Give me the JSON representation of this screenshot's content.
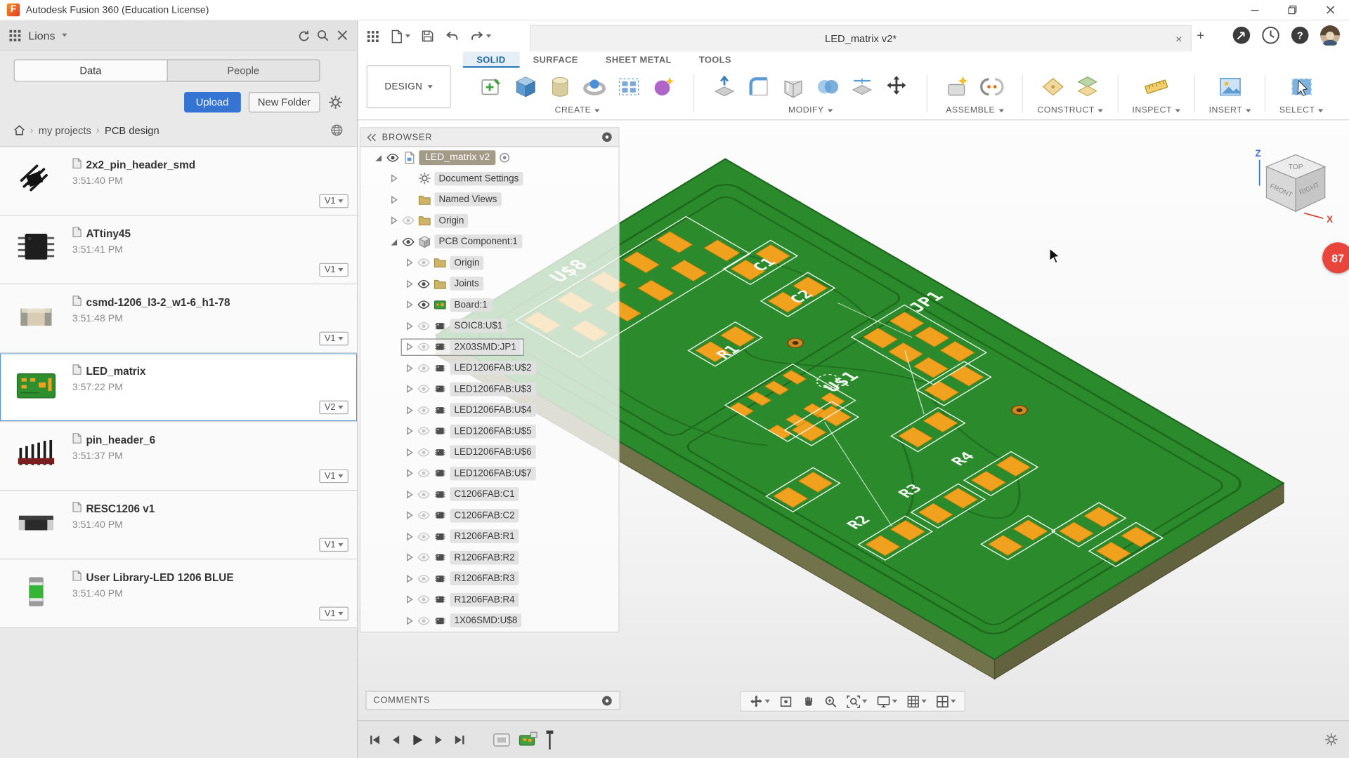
{
  "colors": {
    "accent_blue": "#3574d3",
    "board_green": "#2b8a2b",
    "pad_orange": "#f0a11e",
    "badge_red": "#e8453c",
    "active_tab_blue": "#1a6fb5"
  },
  "titlebar": {
    "title": "Autodesk Fusion 360 (Education License)"
  },
  "data_panel": {
    "team_name": "Lions",
    "tabs": [
      "Data",
      "People"
    ],
    "active_tab": "Data",
    "upload": "Upload",
    "new_folder": "New Folder",
    "breadcrumb": [
      "my projects",
      "PCB design"
    ],
    "items": [
      {
        "name": "2x2_pin_header_smd",
        "time": "3:51:40 PM",
        "version": "V1",
        "thumb": "pin-header-2x2",
        "selected": false
      },
      {
        "name": "ATtiny45",
        "time": "3:51:41 PM",
        "version": "V1",
        "thumb": "attiny45",
        "selected": false
      },
      {
        "name": "csmd-1206_l3-2_w1-6_h1-78",
        "time": "3:51:48 PM",
        "version": "V1",
        "thumb": "capacitor",
        "selected": false
      },
      {
        "name": "LED_matrix",
        "time": "3:57:22 PM",
        "version": "V2",
        "thumb": "pcb",
        "selected": true
      },
      {
        "name": "pin_header_6",
        "time": "3:51:37 PM",
        "version": "V1",
        "thumb": "pin-header-6",
        "selected": false
      },
      {
        "name": "RESC1206 v1",
        "time": "3:51:40 PM",
        "version": "V1",
        "thumb": "resistor",
        "selected": false
      },
      {
        "name": "User Library-LED 1206 BLUE",
        "time": "3:51:40 PM",
        "version": "V1",
        "thumb": "led",
        "selected": false
      }
    ]
  },
  "app_toolbar": {
    "document_tab": "LED_matrix v2*"
  },
  "ribbon": {
    "design_button": "DESIGN",
    "tabs": [
      {
        "label": "SOLID",
        "active": true
      },
      {
        "label": "SURFACE",
        "active": false
      },
      {
        "label": "SHEET METAL",
        "active": false
      },
      {
        "label": "TOOLS",
        "active": false
      }
    ],
    "groups": [
      "CREATE",
      "MODIFY",
      "ASSEMBLE",
      "CONSTRUCT",
      "INSPECT",
      "INSERT",
      "SELECT"
    ]
  },
  "browser": {
    "header": "BROWSER",
    "root": {
      "label": "LED_matrix v2"
    },
    "items": [
      {
        "label": "Document Settings",
        "depth": 1,
        "icon": "gear",
        "eye": "none",
        "expanded": false,
        "boxed": false
      },
      {
        "label": "Named Views",
        "depth": 1,
        "icon": "folder",
        "eye": "none",
        "expanded": false,
        "boxed": false
      },
      {
        "label": "Origin",
        "depth": 1,
        "icon": "folder",
        "eye": "dim",
        "expanded": false,
        "boxed": false
      },
      {
        "label": "PCB Component:1",
        "depth": 1,
        "icon": "component",
        "eye": "on",
        "expanded": true,
        "boxed": false
      },
      {
        "label": "Origin",
        "depth": 2,
        "icon": "folder",
        "eye": "dim",
        "expanded": false,
        "boxed": false
      },
      {
        "label": "Joints",
        "depth": 2,
        "icon": "folder",
        "eye": "on",
        "expanded": false,
        "boxed": false
      },
      {
        "label": "Board:1",
        "depth": 2,
        "icon": "board",
        "eye": "on",
        "expanded": false,
        "boxed": false
      },
      {
        "label": "SOIC8:U$1",
        "depth": 2,
        "icon": "chip",
        "eye": "dim",
        "expanded": false,
        "boxed": false
      },
      {
        "label": "2X03SMD:JP1",
        "depth": 2,
        "icon": "chip",
        "eye": "dim",
        "expanded": false,
        "boxed": true
      },
      {
        "label": "LED1206FAB:U$2",
        "depth": 2,
        "icon": "chip",
        "eye": "dim",
        "expanded": false,
        "boxed": false
      },
      {
        "label": "LED1206FAB:U$3",
        "depth": 2,
        "icon": "chip",
        "eye": "dim",
        "expanded": false,
        "boxed": false
      },
      {
        "label": "LED1206FAB:U$4",
        "depth": 2,
        "icon": "chip",
        "eye": "dim",
        "expanded": false,
        "boxed": false
      },
      {
        "label": "LED1206FAB:U$5",
        "depth": 2,
        "icon": "chip",
        "eye": "dim",
        "expanded": false,
        "boxed": false
      },
      {
        "label": "LED1206FAB:U$6",
        "depth": 2,
        "icon": "chip",
        "eye": "dim",
        "expanded": false,
        "boxed": false
      },
      {
        "label": "LED1206FAB:U$7",
        "depth": 2,
        "icon": "chip",
        "eye": "dim",
        "expanded": false,
        "boxed": false
      },
      {
        "label": "C1206FAB:C1",
        "depth": 2,
        "icon": "chip",
        "eye": "dim",
        "expanded": false,
        "boxed": false
      },
      {
        "label": "C1206FAB:C2",
        "depth": 2,
        "icon": "chip",
        "eye": "dim",
        "expanded": false,
        "boxed": false
      },
      {
        "label": "R1206FAB:R1",
        "depth": 2,
        "icon": "chip",
        "eye": "dim",
        "expanded": false,
        "boxed": false
      },
      {
        "label": "R1206FAB:R2",
        "depth": 2,
        "icon": "chip",
        "eye": "dim",
        "expanded": false,
        "boxed": false
      },
      {
        "label": "R1206FAB:R3",
        "depth": 2,
        "icon": "chip",
        "eye": "dim",
        "expanded": false,
        "boxed": false
      },
      {
        "label": "R1206FAB:R4",
        "depth": 2,
        "icon": "chip",
        "eye": "dim",
        "expanded": false,
        "boxed": false
      },
      {
        "label": "1X06SMD:U$8",
        "depth": 2,
        "icon": "chip",
        "eye": "dim",
        "expanded": false,
        "boxed": false
      }
    ]
  },
  "viewport": {
    "silkscreen_labels": [
      "U$8",
      "C1",
      "C2",
      "JP1",
      "R1",
      "U$1",
      "R4",
      "R3",
      "R2"
    ],
    "viewcube": {
      "top": "TOP",
      "front": "FRONT",
      "right": "RIGHT",
      "axes": [
        "Z",
        "X"
      ]
    },
    "notification_badge": "87",
    "comments": {
      "label": "COMMENTS"
    }
  }
}
